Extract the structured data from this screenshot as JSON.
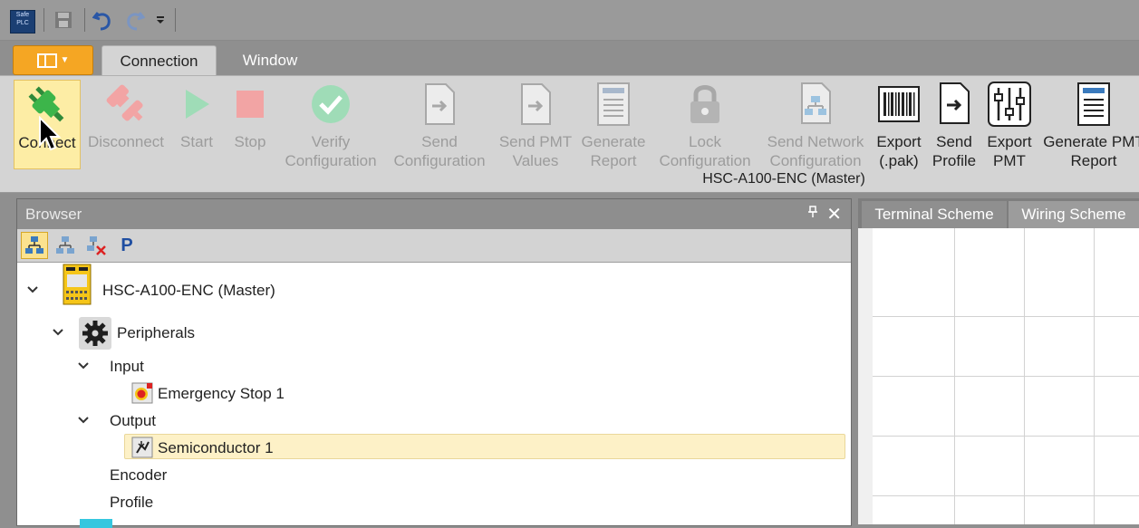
{
  "qat": {
    "logo_text": "Safe PLC",
    "icons": [
      "save-icon",
      "undo-icon",
      "redo-icon",
      "customize-icon"
    ]
  },
  "tabs": {
    "file_icon": "app-menu-icon",
    "connection": "Connection",
    "window": "Window"
  },
  "ribbon": {
    "buttons": [
      {
        "label_l1": "Connect",
        "label_l2": "",
        "icon": "plug-connect-icon",
        "enabled": true,
        "selected": true
      },
      {
        "label_l1": "Disconnect",
        "label_l2": "",
        "icon": "plug-disconnect-icon",
        "enabled": false
      },
      {
        "label_l1": "Start",
        "label_l2": "",
        "icon": "play-icon",
        "enabled": false
      },
      {
        "label_l1": "Stop",
        "label_l2": "",
        "icon": "stop-icon",
        "enabled": false
      },
      {
        "label_l1": "Verify",
        "label_l2": "Configuration",
        "icon": "verify-icon",
        "enabled": false
      },
      {
        "label_l1": "Send",
        "label_l2": "Configuration",
        "icon": "send-config-icon",
        "enabled": false
      },
      {
        "label_l1": "Send PMT",
        "label_l2": "Values",
        "icon": "send-pmt-icon",
        "enabled": false
      },
      {
        "label_l1": "Generate",
        "label_l2": "Report",
        "icon": "report-icon",
        "enabled": false
      },
      {
        "label_l1": "Lock",
        "label_l2": "Configuration",
        "icon": "lock-icon",
        "enabled": false
      },
      {
        "label_l1": "Send Network",
        "label_l2": "Configuration",
        "icon": "network-config-icon",
        "enabled": false
      },
      {
        "label_l1": "Export",
        "label_l2": "(.pak)",
        "icon": "barcode-icon",
        "enabled": true
      },
      {
        "label_l1": "Send",
        "label_l2": "Profile",
        "icon": "send-profile-icon",
        "enabled": true
      },
      {
        "label_l1": "Export",
        "label_l2": "PMT",
        "icon": "sliders-icon",
        "enabled": true
      },
      {
        "label_l1": "Generate PMT",
        "label_l2": "Report",
        "icon": "pmt-report-icon",
        "enabled": true
      }
    ],
    "group_label": "HSC-A100-ENC (Master)"
  },
  "browser": {
    "title": "Browser",
    "toolbar_icons": [
      "network-tree-icon",
      "network-add-icon",
      "network-remove-icon",
      "parameter-icon"
    ],
    "p_label": "P",
    "tree": {
      "master": "HSC-A100-ENC (Master)",
      "peripherals": "Peripherals",
      "input": "Input",
      "emergency_stop": "Emergency Stop 1",
      "output": "Output",
      "semiconductor": "Semiconductor 1",
      "encoder": "Encoder",
      "profile": "Profile"
    }
  },
  "scheme": {
    "tab_terminal": "Terminal Scheme",
    "tab_wiring": "Wiring Scheme"
  }
}
